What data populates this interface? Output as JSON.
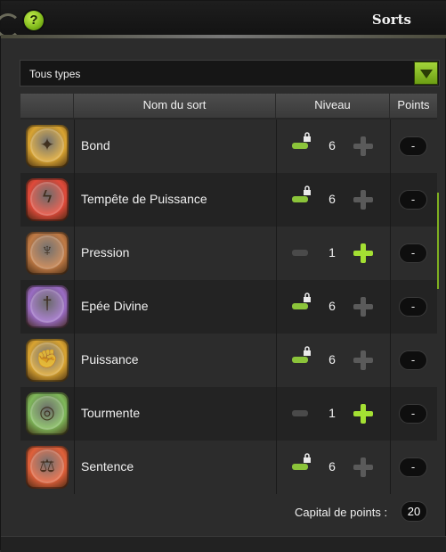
{
  "window": {
    "title": "Sorts",
    "help_label": "?"
  },
  "filter": {
    "value": "Tous types"
  },
  "table": {
    "headers": {
      "name": "Nom du sort",
      "level": "Niveau",
      "points": "Points"
    },
    "rows": [
      {
        "name": "Bond",
        "level": "6",
        "points": "-",
        "minus_state": "locked",
        "plus_state": "disabled",
        "icon": "jump-spell-icon",
        "color": "#d9a431"
      },
      {
        "name": "Tempête de Puissance",
        "level": "6",
        "points": "-",
        "minus_state": "locked",
        "plus_state": "disabled",
        "icon": "power-storm-spell-icon",
        "color": "#e04a3a"
      },
      {
        "name": "Pression",
        "level": "1",
        "points": "-",
        "minus_state": "disabled",
        "plus_state": "active",
        "icon": "pressure-spell-icon",
        "color": "#c07a45"
      },
      {
        "name": "Epée Divine",
        "level": "6",
        "points": "-",
        "minus_state": "locked",
        "plus_state": "disabled",
        "icon": "divine-sword-spell-icon",
        "color": "#9a6cc4"
      },
      {
        "name": "Puissance",
        "level": "6",
        "points": "-",
        "minus_state": "locked",
        "plus_state": "disabled",
        "icon": "power-spell-icon",
        "color": "#d9a431"
      },
      {
        "name": "Tourmente",
        "level": "1",
        "points": "-",
        "minus_state": "disabled",
        "plus_state": "active",
        "icon": "torment-spell-icon",
        "color": "#7fb85a"
      },
      {
        "name": "Sentence",
        "level": "6",
        "points": "-",
        "minus_state": "locked",
        "plus_state": "disabled",
        "icon": "sentence-spell-icon",
        "color": "#e0603a"
      }
    ]
  },
  "capital": {
    "label": "Capital de points :",
    "value": "20"
  },
  "colors": {
    "accent_green": "#a4e033",
    "bg": "#2c2c2c"
  }
}
